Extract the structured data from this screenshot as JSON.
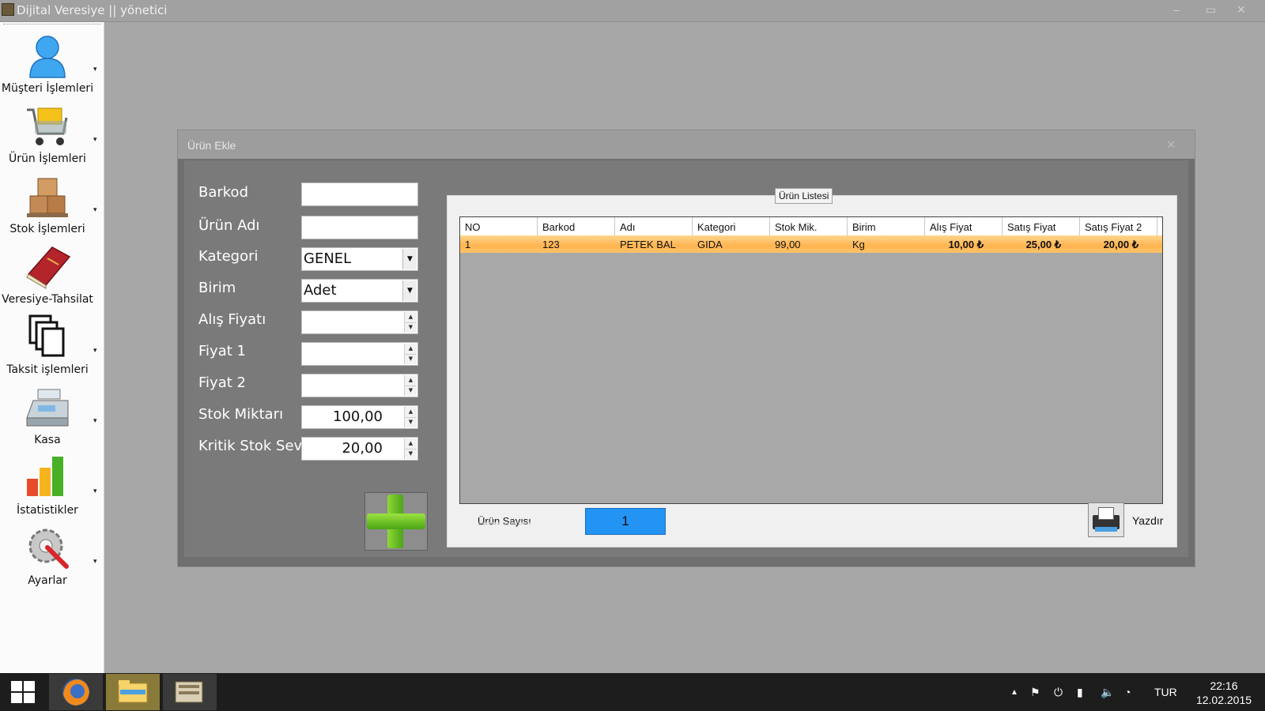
{
  "app": {
    "title": "Dijital Veresiye  ||  yönetici"
  },
  "window_controls": {
    "minimize": "–",
    "maximize": "▭",
    "close": "✕"
  },
  "sidebar": {
    "items": [
      {
        "label": "Müşteri İşlemleri",
        "icon": "user-icon"
      },
      {
        "label": "Ürün İşlemleri",
        "icon": "shopping-cart-icon"
      },
      {
        "label": "Stok İşlemleri",
        "icon": "boxes-icon"
      },
      {
        "label": "Veresiye-Tahsilat",
        "icon": "book-icon"
      },
      {
        "label": "Taksit işlemleri",
        "icon": "copy-pages-icon"
      },
      {
        "label": "Kasa",
        "icon": "cash-register-icon"
      },
      {
        "label": "İstatistikler",
        "icon": "bar-chart-icon"
      },
      {
        "label": "Ayarlar",
        "icon": "settings-tools-icon"
      }
    ],
    "arrow": "▾"
  },
  "dialog": {
    "title": "Ürün Ekle",
    "close": "✕",
    "form": {
      "barkod": {
        "label": "Barkod",
        "value": ""
      },
      "urun_adi": {
        "label": "Ürün Adı",
        "value": ""
      },
      "kategori": {
        "label": "Kategori",
        "value": "GENEL"
      },
      "birim": {
        "label": "Birim",
        "value": "Adet"
      },
      "alis_fiyati": {
        "label": "Alış Fiyatı",
        "value": ""
      },
      "fiyat1": {
        "label": "Fiyat 1",
        "value": ""
      },
      "fiyat2": {
        "label": "Fiyat 2",
        "value": ""
      },
      "stok_miktari": {
        "label": "Stok Miktarı",
        "value": "100,00"
      },
      "kritik_stok": {
        "label": "Kritik Stok Sev.",
        "value": "20,00"
      }
    },
    "list": {
      "legend": "Ürün Listesi",
      "columns": [
        "NO",
        "Barkod",
        "Adı",
        "Kategori",
        "Stok Mik.",
        "Birim",
        "Alış Fiyat",
        "Satış Fiyat",
        "Satış Fiyat 2"
      ],
      "rows": [
        [
          "1",
          "123",
          "PETEK BAL",
          "GIDA",
          "99,00",
          "Kg",
          "10,00 ₺",
          "25,00 ₺",
          "20,00 ₺"
        ]
      ],
      "count_label": "Ürün Sayısı",
      "count_value": "1",
      "print_label": "Yazdır"
    }
  },
  "taskbar": {
    "apps": [
      "firefox-icon",
      "file-explorer-icon",
      "dijital-veresiye-icon"
    ],
    "language": "TUR",
    "time": "22:16",
    "date": "12.02.2015"
  },
  "colors": {
    "accent": "#2393f4",
    "row_highlight": "#ffb450",
    "add_green": "#4aa514"
  }
}
